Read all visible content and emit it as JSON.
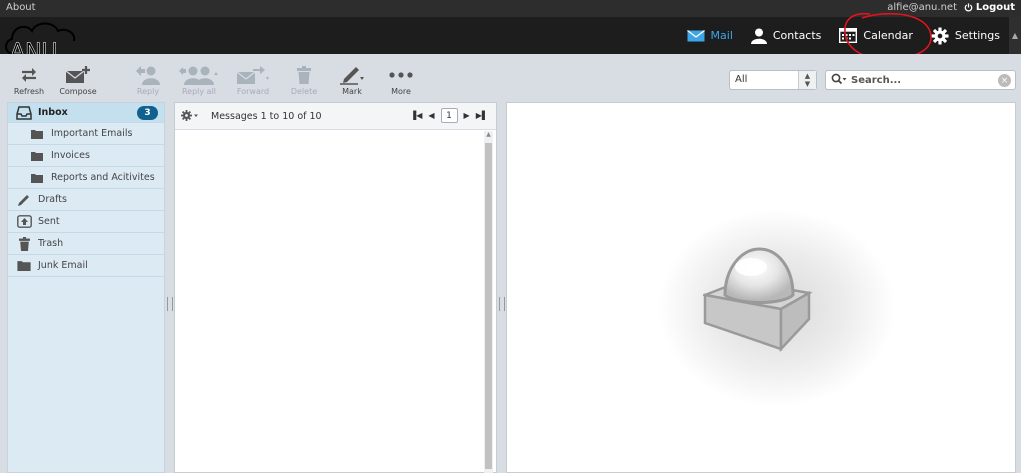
{
  "topbar": {
    "about": "About",
    "user": "alfie@anu.net",
    "logout": "Logout"
  },
  "brand": {
    "logo_text": "ANU"
  },
  "nav": {
    "mail": "Mail",
    "contacts": "Contacts",
    "calendar": "Calendar",
    "settings": "Settings"
  },
  "toolbar": {
    "refresh": "Refresh",
    "compose": "Compose",
    "reply": "Reply",
    "reply_all": "Reply all",
    "forward": "Forward",
    "delete": "Delete",
    "mark": "Mark",
    "more": "More"
  },
  "filter": {
    "value": "All"
  },
  "search": {
    "placeholder": "Search..."
  },
  "folders": [
    {
      "label": "Inbox",
      "icon": "inbox-icon",
      "badge": "3"
    },
    {
      "label": "Important Emails",
      "icon": "folder-icon"
    },
    {
      "label": "Invoices",
      "icon": "folder-icon"
    },
    {
      "label": "Reports and Acitivites",
      "icon": "folder-icon"
    },
    {
      "label": "Drafts",
      "icon": "pencil-icon"
    },
    {
      "label": "Sent",
      "icon": "sent-icon"
    },
    {
      "label": "Trash",
      "icon": "trash-icon"
    },
    {
      "label": "Junk Email",
      "icon": "folder-icon"
    }
  ],
  "messages": {
    "count_text": "Messages 1 to 10 of 10",
    "page": "1"
  },
  "colors": {
    "accent": "#3fa5e7",
    "badge": "#11618e",
    "annotation": "#e0141e"
  }
}
